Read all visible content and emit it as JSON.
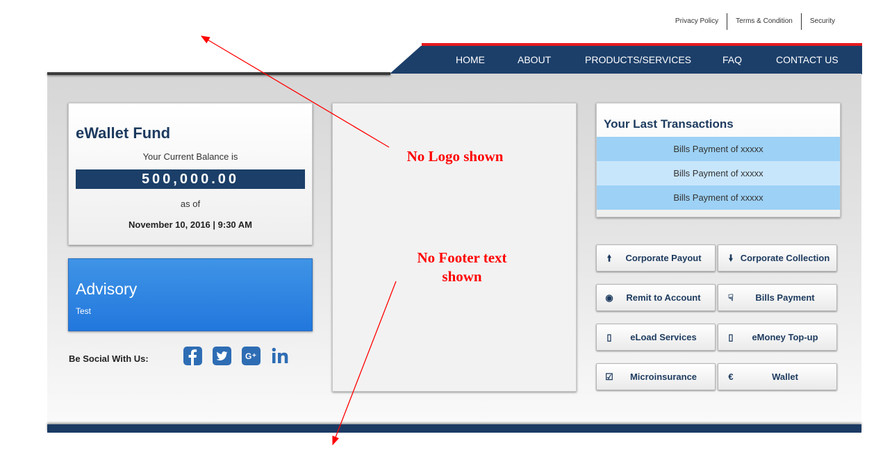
{
  "top_links": [
    "Privacy Policy",
    "Terms & Condition",
    "Security"
  ],
  "nav": [
    "HOME",
    "ABOUT",
    "PRODUCTS/SERVICES",
    "FAQ",
    "CONTACT US"
  ],
  "wallet": {
    "title": "eWallet Fund",
    "subtitle": "Your Current Balance is",
    "balance": "500,000.00",
    "as_of": "as of",
    "date": "November 10, 2016 | 9:30 AM"
  },
  "advisory": {
    "title": "Advisory",
    "text": "Test"
  },
  "social": {
    "label": "Be Social With Us:",
    "icons": [
      "facebook-icon",
      "twitter-icon",
      "google-plus-icon",
      "linkedin-icon"
    ],
    "color": "#2e6db4"
  },
  "transactions": {
    "title": "Your Last Transactions",
    "rows": [
      "Bills Payment of xxxxx",
      "Bills Payment of xxxxx",
      "Bills Payment of xxxxx"
    ]
  },
  "actions": [
    {
      "label": "Corporate Payout",
      "icon": "arrow-up-icon"
    },
    {
      "label": "Corporate Collection",
      "icon": "arrow-down-icon"
    },
    {
      "label": "Remit to Account",
      "icon": "globe-icon"
    },
    {
      "label": "Bills Payment",
      "icon": "hand-icon"
    },
    {
      "label": "eLoad Services",
      "icon": "mobile-icon"
    },
    {
      "label": "eMoney Top-up",
      "icon": "mobile-icon"
    },
    {
      "label": "Microinsurance",
      "icon": "check-square-icon"
    },
    {
      "label": "Wallet",
      "icon": "euro-icon"
    }
  ],
  "annotations": {
    "no_logo": "No Logo shown",
    "no_footer_line1": "No Footer text",
    "no_footer_line2": "shown"
  },
  "colors": {
    "navy": "#1c3f6a",
    "accent_red": "#e8191e",
    "advisory_blue": "#2a80e0",
    "row_dark": "#9dd1f5",
    "row_light": "#c8e6fb",
    "annotation": "#ff0000"
  }
}
